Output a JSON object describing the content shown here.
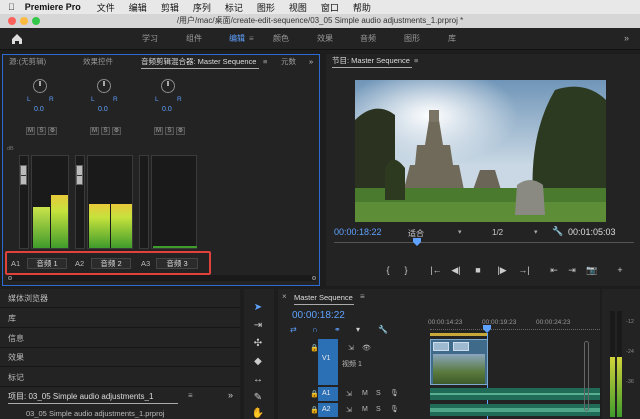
{
  "menubar": {
    "app": "Premiere Pro",
    "items": [
      "文件",
      "编辑",
      "剪辑",
      "序列",
      "标记",
      "图形",
      "视图",
      "窗口",
      "帮助"
    ]
  },
  "titlebar": {
    "path": "/用户/mac/桌面/create-edit-sequence/03_05 Simple audio adjustments_1.prproj *"
  },
  "workspaces": {
    "items": [
      "学习",
      "组件",
      "编辑",
      "颜色",
      "效果",
      "音频",
      "图形",
      "库"
    ],
    "active": "编辑"
  },
  "mixer_panel": {
    "tabs": [
      "源:(无剪辑)",
      "效果控件",
      "音频剪辑混合器: Master Sequence",
      "元数"
    ],
    "channels": [
      {
        "track": "A1",
        "name": "音频 1",
        "l": "L",
        "r": "R",
        "value": "0.0",
        "meter_level": 0.58,
        "meter_level_r": 0.45
      },
      {
        "track": "A2",
        "name": "音频 2",
        "l": "L",
        "r": "R",
        "value": "0.0",
        "meter_level": 0.5,
        "meter_level_r": 0.5
      },
      {
        "track": "A3",
        "name": "音频 3",
        "l": "L",
        "r": "R",
        "value": "0.0",
        "meter_level": 0.0,
        "meter_level_r": 0.0
      }
    ],
    "buttons": [
      "M",
      "S",
      "R"
    ],
    "db_label": "dB",
    "db_scale": [
      "-",
      "-",
      "-",
      "-",
      "-",
      "-",
      "-",
      "-",
      "-",
      "-",
      "-",
      "-"
    ]
  },
  "program_panel": {
    "title": "节目: Master Sequence",
    "timecode": "00:00:18:22",
    "fit": "适合",
    "resolution": "1/2",
    "duration": "00:01:05:03",
    "controls": [
      "{",
      "}",
      "|←",
      "◀|",
      "■",
      "|▶",
      "→|",
      "⇤",
      "⇥",
      "📷",
      "+"
    ]
  },
  "project_panel": {
    "items": [
      "媒体浏览器",
      "库",
      "信息",
      "效果",
      "标记"
    ],
    "project_title": "项目: 03_05 Simple audio adjustments_1",
    "project_file": "03_05 Simple audio adjustments_1.prproj"
  },
  "timeline_panel": {
    "title": "Master Sequence",
    "timecode": "00:00:18:22",
    "ruler": [
      "00:00:14:23",
      "00:00:19:23",
      "00:00:24:23"
    ],
    "tracks": [
      {
        "id": "V1",
        "name": "视频 1"
      },
      {
        "id": "A1",
        "m": "M",
        "s": "S"
      },
      {
        "id": "A2",
        "m": "M",
        "s": "S"
      }
    ]
  },
  "meters_panel": {
    "scale": [
      "-12",
      "-24",
      "-36"
    ]
  },
  "colors": {
    "accent": "#2d6ad1",
    "timecode": "#5fa2ff",
    "highlight_box": "#e0413a"
  }
}
